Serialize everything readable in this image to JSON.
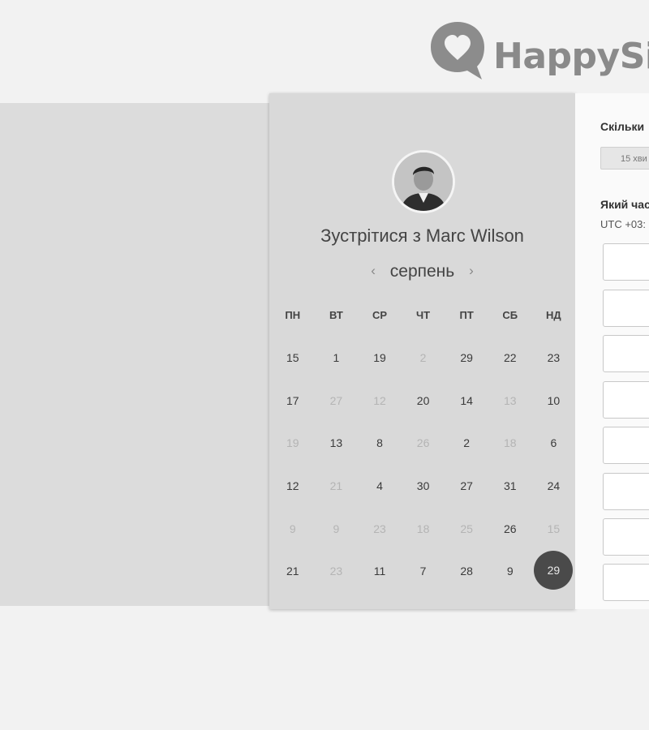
{
  "brand": {
    "name": "HappySig"
  },
  "calendar": {
    "meet_title": "Зустрітися з Marc Wilson",
    "month": "серпень",
    "prev_icon": "chevron-left-icon",
    "next_icon": "chevron-right-icon",
    "weekdays": [
      "ПН",
      "ВТ",
      "СР",
      "ЧТ",
      "ПТ",
      "СБ",
      "НД"
    ],
    "weeks": [
      [
        {
          "d": "15",
          "m": false
        },
        {
          "d": "1",
          "m": false
        },
        {
          "d": "19",
          "m": false
        },
        {
          "d": "2",
          "m": true
        },
        {
          "d": "29",
          "m": false
        },
        {
          "d": "22",
          "m": false
        },
        {
          "d": "23",
          "m": false
        }
      ],
      [
        {
          "d": "17",
          "m": false
        },
        {
          "d": "27",
          "m": true
        },
        {
          "d": "12",
          "m": true
        },
        {
          "d": "20",
          "m": false
        },
        {
          "d": "14",
          "m": false
        },
        {
          "d": "13",
          "m": true
        },
        {
          "d": "10",
          "m": false
        }
      ],
      [
        {
          "d": "19",
          "m": true
        },
        {
          "d": "13",
          "m": false
        },
        {
          "d": "8",
          "m": false
        },
        {
          "d": "26",
          "m": true
        },
        {
          "d": "2",
          "m": false
        },
        {
          "d": "18",
          "m": true
        },
        {
          "d": "6",
          "m": false
        }
      ],
      [
        {
          "d": "12",
          "m": false
        },
        {
          "d": "21",
          "m": true
        },
        {
          "d": "4",
          "m": false
        },
        {
          "d": "30",
          "m": false
        },
        {
          "d": "27",
          "m": false
        },
        {
          "d": "31",
          "m": false
        },
        {
          "d": "24",
          "m": false
        }
      ],
      [
        {
          "d": "9",
          "m": true
        },
        {
          "d": "9",
          "m": true
        },
        {
          "d": "23",
          "m": true
        },
        {
          "d": "18",
          "m": true
        },
        {
          "d": "25",
          "m": true
        },
        {
          "d": "26",
          "m": false
        },
        {
          "d": "15",
          "m": true
        }
      ],
      [
        {
          "d": "21",
          "m": false
        },
        {
          "d": "23",
          "m": true
        },
        {
          "d": "11",
          "m": false
        },
        {
          "d": "7",
          "m": false
        },
        {
          "d": "28",
          "m": false
        },
        {
          "d": "9",
          "m": false
        },
        {
          "d": "29",
          "m": false,
          "selected": true
        }
      ]
    ]
  },
  "booking": {
    "duration_question": "Скільки",
    "duration_option": "15 хви",
    "time_question": "Який час",
    "timezone": "UTC +03:"
  }
}
